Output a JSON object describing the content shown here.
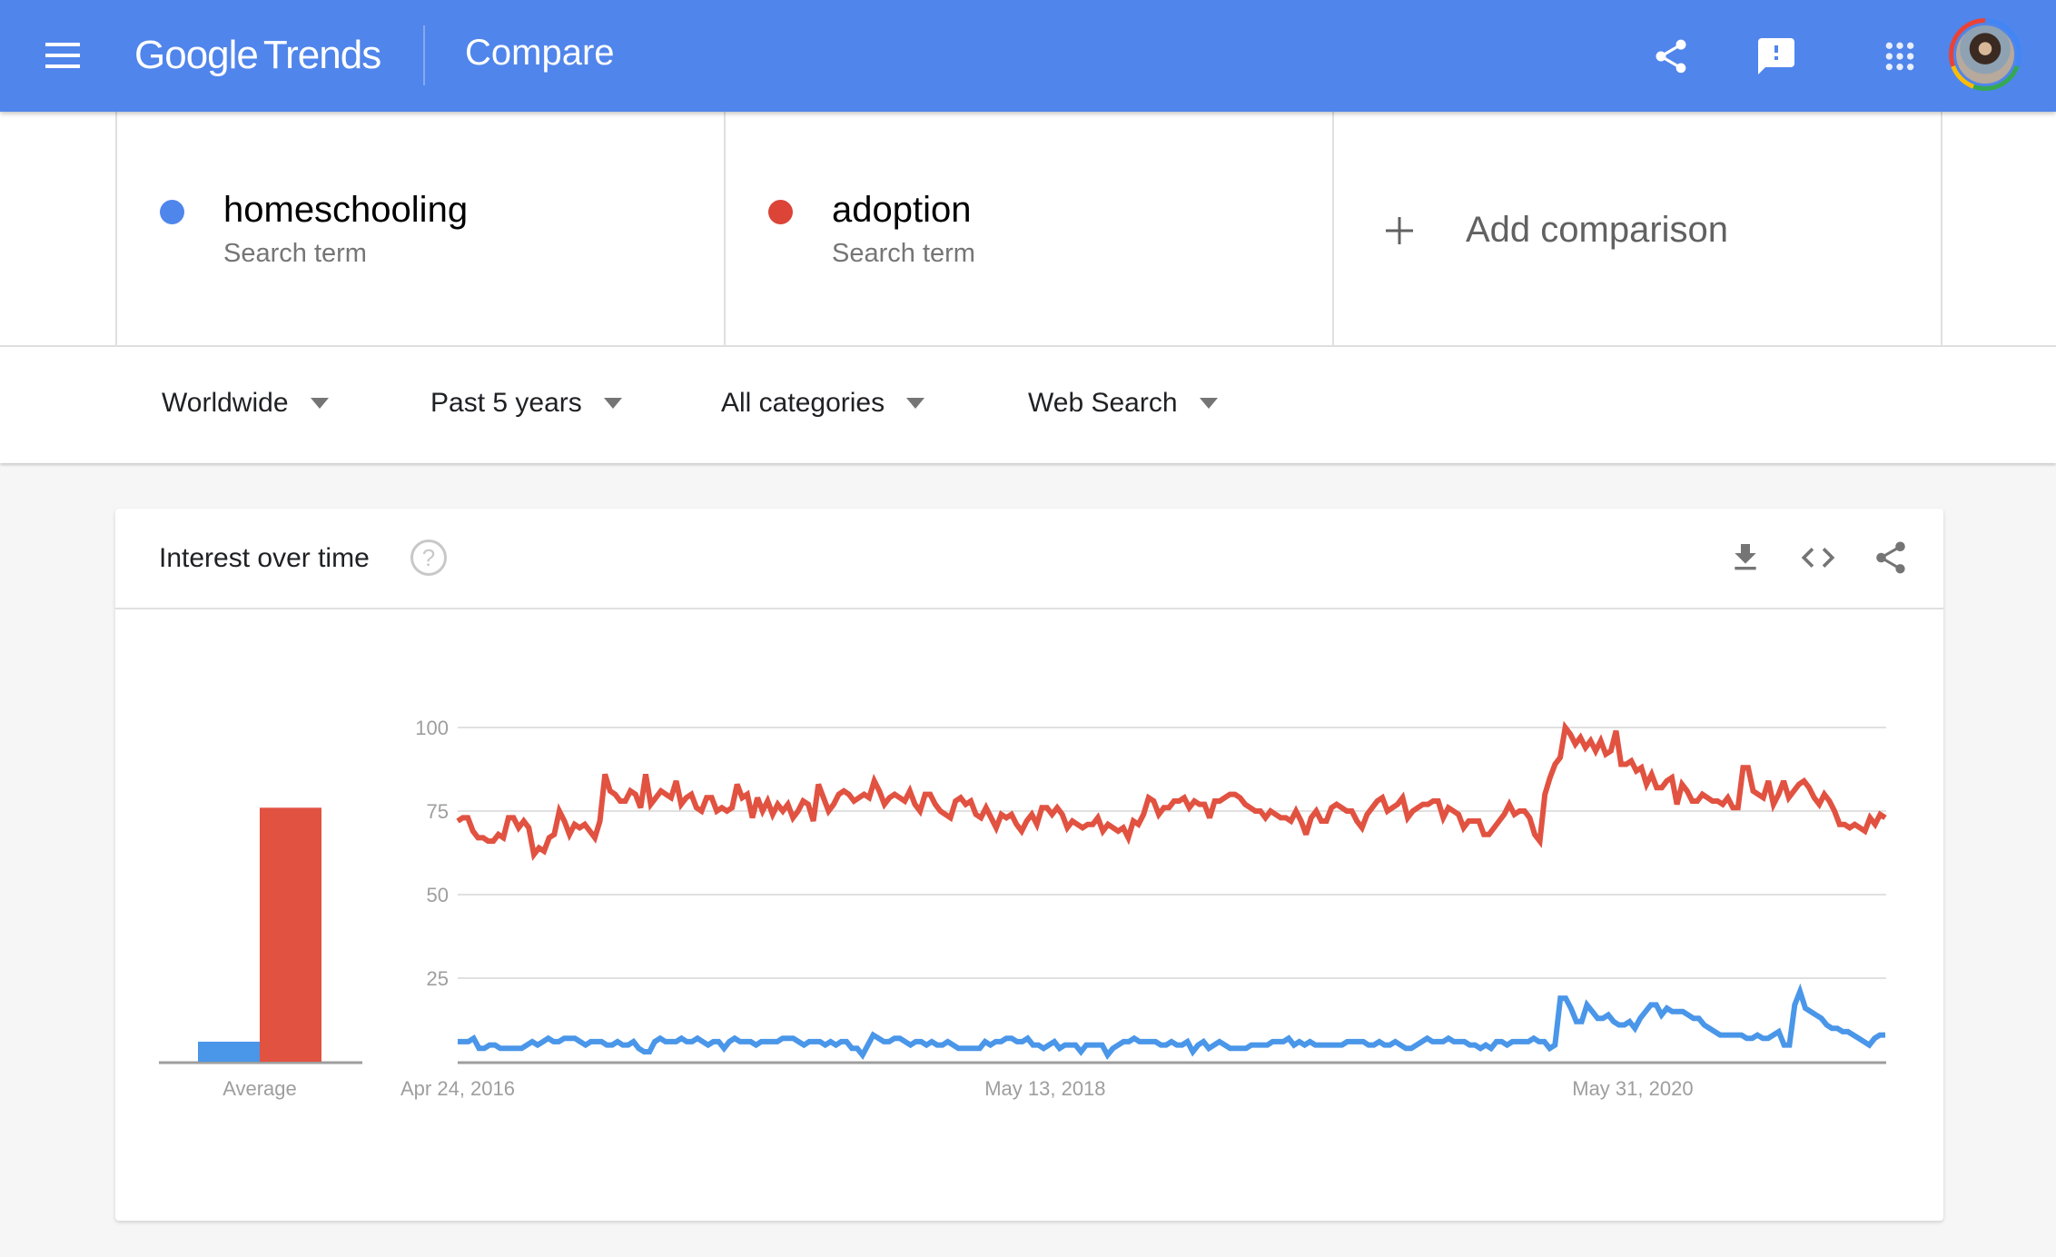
{
  "header": {
    "menu_icon": "hamburger-menu-icon",
    "logo_google": "Google",
    "logo_trends": "Trends",
    "page_title": "Compare",
    "icons": [
      "share-icon",
      "feedback-icon",
      "apps-grid-icon"
    ],
    "avatar": "user-avatar"
  },
  "terms": [
    {
      "name": "homeschooling",
      "type": "Search term",
      "color": "#4f86ec"
    },
    {
      "name": "adoption",
      "type": "Search term",
      "color": "#db4437"
    }
  ],
  "add_comparison": {
    "icon": "plus-icon",
    "label": "Add comparison"
  },
  "filters": [
    {
      "label": "Worldwide"
    },
    {
      "label": "Past 5 years"
    },
    {
      "label": "All categories"
    },
    {
      "label": "Web Search"
    }
  ],
  "card": {
    "title": "Interest over time",
    "help_icon": "help-circle-icon",
    "actions": [
      "download-icon",
      "embed-code-icon",
      "share-icon"
    ]
  },
  "chart_data": {
    "type": "line",
    "title": "Interest over time",
    "xlabel": "",
    "ylabel": "",
    "ylim": [
      0,
      100
    ],
    "yticks": [
      25,
      50,
      75,
      100
    ],
    "grid": true,
    "x_tick_labels": [
      "Apr 24, 2016",
      "May 13, 2018",
      "May 31, 2020"
    ],
    "x_tick_fractions": [
      0.0,
      0.4115,
      0.8231
    ],
    "average": {
      "label": "Average",
      "values": [
        {
          "name": "homeschooling",
          "value": 6
        },
        {
          "name": "adoption",
          "value": 76
        }
      ]
    },
    "series": [
      {
        "name": "homeschooling",
        "color": "#4a96e9",
        "values": [
          6,
          6,
          6,
          7,
          4,
          4,
          5,
          5,
          4,
          4,
          4,
          4,
          4,
          5,
          6,
          5,
          6,
          7,
          6,
          6,
          7,
          7,
          7,
          6,
          5,
          6,
          6,
          6,
          5,
          5,
          6,
          5,
          5,
          6,
          4,
          3,
          3,
          6,
          7,
          6,
          6,
          6,
          7,
          6,
          6,
          7,
          6,
          5,
          6,
          6,
          4,
          6,
          7,
          6,
          6,
          6,
          5,
          6,
          6,
          6,
          6,
          7,
          7,
          7,
          6,
          5,
          6,
          6,
          6,
          5,
          6,
          5,
          6,
          6,
          4,
          4,
          2,
          5,
          8,
          7,
          6,
          6,
          7,
          7,
          6,
          5,
          6,
          6,
          5,
          6,
          5,
          5,
          6,
          5,
          4,
          4,
          4,
          4,
          4,
          6,
          5,
          6,
          6,
          7,
          7,
          6,
          6,
          7,
          5,
          5,
          4,
          5,
          6,
          4,
          5,
          5,
          5,
          3,
          5,
          5,
          5,
          5,
          2,
          4,
          5,
          6,
          6,
          7,
          6,
          6,
          6,
          6,
          5,
          5,
          6,
          5,
          5,
          6,
          3,
          5,
          6,
          4,
          5,
          6,
          5,
          4,
          4,
          4,
          4,
          5,
          5,
          5,
          5,
          6,
          6,
          6,
          7,
          5,
          6,
          5,
          6,
          5,
          5,
          5,
          5,
          5,
          5,
          6,
          6,
          6,
          6,
          5,
          5,
          6,
          5,
          5,
          6,
          5,
          4,
          4,
          5,
          6,
          7,
          6,
          6,
          6,
          7,
          6,
          6,
          6,
          5,
          5,
          4,
          5,
          4,
          6,
          6,
          5,
          6,
          6,
          6,
          6,
          7,
          6,
          6,
          4,
          5,
          19,
          19,
          16,
          12,
          12,
          17,
          15,
          13,
          13,
          14,
          12,
          11,
          11,
          12,
          10,
          13,
          15,
          17,
          17,
          14,
          16,
          15,
          15,
          15,
          14,
          13,
          13,
          11,
          10,
          9,
          8,
          8,
          8,
          8,
          8,
          7,
          7,
          8,
          7,
          7,
          8,
          9,
          5,
          5,
          17,
          21,
          16,
          15,
          14,
          13,
          11,
          10,
          10,
          9,
          9,
          8,
          7,
          6,
          5,
          7,
          8,
          8
        ]
      },
      {
        "name": "adoption",
        "color": "#e15241",
        "values": [
          72,
          73,
          73,
          69,
          67,
          67,
          66,
          66,
          68,
          67,
          73,
          73,
          70,
          72,
          70,
          62,
          64,
          63,
          67,
          68,
          75,
          72,
          68,
          71,
          70,
          71,
          69,
          67,
          72,
          86,
          81,
          80,
          78,
          78,
          81,
          80,
          76,
          86,
          77,
          79,
          81,
          80,
          79,
          84,
          77,
          79,
          80,
          76,
          75,
          79,
          79,
          75,
          76,
          75,
          76,
          83,
          79,
          80,
          73,
          79,
          75,
          78,
          74,
          77,
          75,
          77,
          73,
          75,
          78,
          77,
          72,
          83,
          79,
          75,
          77,
          80,
          81,
          80,
          78,
          79,
          80,
          79,
          84,
          81,
          77,
          79,
          80,
          79,
          78,
          81,
          77,
          75,
          80,
          80,
          77,
          75,
          74,
          73,
          78,
          79,
          77,
          78,
          74,
          73,
          76,
          73,
          70,
          74,
          73,
          74,
          71,
          69,
          72,
          74,
          71,
          76,
          76,
          74,
          76,
          74,
          70,
          72,
          71,
          70,
          71,
          71,
          73,
          69,
          71,
          70,
          69,
          70,
          67,
          72,
          71,
          74,
          79,
          78,
          74,
          76,
          76,
          78,
          78,
          79,
          76,
          78,
          77,
          77,
          73,
          78,
          78,
          79,
          80,
          80,
          79,
          77,
          76,
          75,
          75,
          73,
          75,
          74,
          73,
          73,
          72,
          75,
          72,
          68,
          73,
          75,
          72,
          72,
          76,
          77,
          76,
          75,
          75,
          72,
          70,
          74,
          76,
          78,
          79,
          75,
          76,
          77,
          79,
          73,
          75,
          76,
          77,
          77,
          78,
          78,
          73,
          76,
          75,
          74,
          70,
          72,
          72,
          72,
          68,
          68,
          70,
          72,
          74,
          77,
          74,
          75,
          75,
          73,
          68,
          66,
          80,
          85,
          89,
          91,
          100,
          98,
          95,
          97,
          94,
          96,
          93,
          96,
          92,
          93,
          99,
          89,
          89,
          90,
          87,
          88,
          83,
          86,
          82,
          82,
          84,
          85,
          77,
          83,
          81,
          78,
          78,
          80,
          79,
          78,
          78,
          77,
          79,
          76,
          76,
          88,
          88,
          81,
          80,
          79,
          84,
          77,
          80,
          84,
          79,
          81,
          83,
          84,
          82,
          79,
          77,
          80,
          78,
          75,
          71,
          71,
          70,
          71,
          70,
          69,
          73,
          71,
          74,
          73
        ]
      }
    ]
  }
}
